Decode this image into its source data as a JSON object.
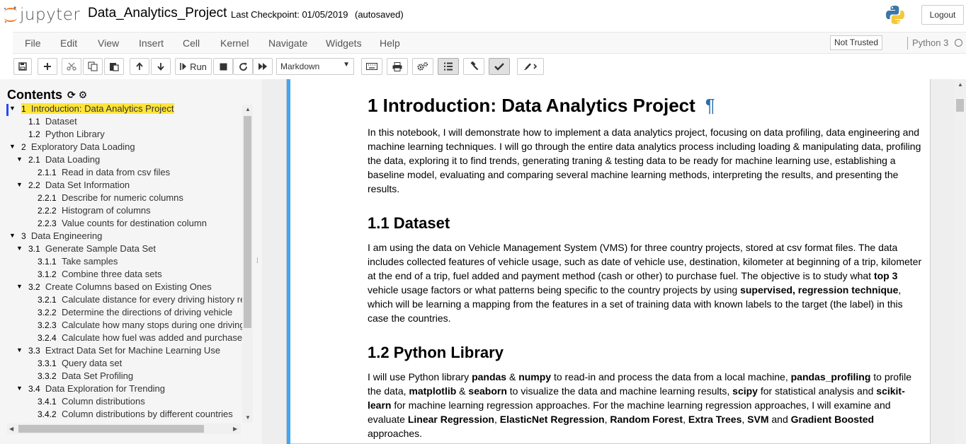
{
  "header": {
    "logo_text": "jupyter",
    "notebook_name": "Data_Analytics_Project",
    "checkpoint": "Last Checkpoint: 01/05/2019",
    "autosave": "(autosaved)",
    "logout_label": "Logout"
  },
  "menubar": {
    "items": [
      "File",
      "Edit",
      "View",
      "Insert",
      "Cell",
      "Kernel",
      "Navigate",
      "Widgets",
      "Help"
    ],
    "trust_label": "Not Trusted",
    "kernel_name": "Python 3"
  },
  "toolbar": {
    "run_label": "Run",
    "cell_type": "Markdown",
    "buttons": [
      "save-icon",
      "plus-icon",
      "cut-icon",
      "copy-icon",
      "paste-icon",
      "arrow-up-icon",
      "arrow-down-icon",
      "run-icon",
      "stop-icon",
      "restart-icon",
      "fast-forward-icon",
      "keyboard-icon",
      "print-icon",
      "gears-icon",
      "list-icon",
      "gavel-icon",
      "check-icon",
      "brush-icon"
    ]
  },
  "toc": {
    "title": "Contents",
    "items": [
      {
        "num": "1",
        "label": "Introduction: Data Analytics Project",
        "current": true
      },
      {
        "num": "1.1",
        "label": "Dataset"
      },
      {
        "num": "1.2",
        "label": "Python Library"
      },
      {
        "num": "2",
        "label": "Exploratory Data Loading"
      },
      {
        "num": "2.1",
        "label": "Data Loading"
      },
      {
        "num": "2.1.1",
        "label": "Read in data from csv files"
      },
      {
        "num": "2.2",
        "label": "Data Set Information"
      },
      {
        "num": "2.2.1",
        "label": "Describe for numeric columns"
      },
      {
        "num": "2.2.2",
        "label": "Histogram of columns"
      },
      {
        "num": "2.2.3",
        "label": "Value counts for destination column"
      },
      {
        "num": "3",
        "label": "Data Engineering"
      },
      {
        "num": "3.1",
        "label": "Generate Sample Data Set"
      },
      {
        "num": "3.1.1",
        "label": "Take samples"
      },
      {
        "num": "3.1.2",
        "label": "Combine three data sets"
      },
      {
        "num": "3.2",
        "label": "Create Columns based on Existing Ones"
      },
      {
        "num": "3.2.1",
        "label": "Calculate distance for every driving history re"
      },
      {
        "num": "3.2.2",
        "label": "Determine the directions of driving vehicle"
      },
      {
        "num": "3.2.3",
        "label": "Calculate how many stops during one driving"
      },
      {
        "num": "3.2.4",
        "label": "Calculate how fuel was added and purchase"
      },
      {
        "num": "3.3",
        "label": "Extract Data Set for Machine Learning Use"
      },
      {
        "num": "3.3.1",
        "label": "Query data set"
      },
      {
        "num": "3.3.2",
        "label": "Data Set Profiling"
      },
      {
        "num": "3.4",
        "label": "Data Exploration for Trending"
      },
      {
        "num": "3.4.1",
        "label": "Column distributions"
      },
      {
        "num": "3.4.2",
        "label": "Column distributions by different countries"
      }
    ]
  },
  "notebook": {
    "h1": "1  Introduction: Data Analytics Project",
    "pilcrow": "¶",
    "intro": "In this notebook, I will demonstrate how to implement a data analytics project, focusing on data profiling, data engineering and machine learning techniques. I will go through the entire data analytics process including loading & manipulating data, profiling the data, exploring it to find trends, generating traning & testing data to be ready for machine learning use, establishing a baseline model, evaluating and comparing several machine learning methods, interpreting the results, and presenting the results.",
    "h2_dataset": "1.1  Dataset",
    "dataset_p1": "I am using the data on Vehicle Management System (VMS) for three country projects, stored at csv format files. The data includes collected features of vehicle usage, such as date of vehicle use, destination, kilometer at beginning of a trip, kilometer at the end of a trip, fuel added and payment method (cash or other) to purchase fuel. The objective is to study what ",
    "dataset_b1": "top 3",
    "dataset_p2": " vehicle usage factors or what patterns being specific to the country projects by using ",
    "dataset_b2": "supervised, regression technique",
    "dataset_p3": ", which will be learning a mapping from the features in a set of training data with known labels to the target (the label) in this case the countries.",
    "h2_python": "1.2  Python Library",
    "py_parts": [
      {
        "t": "I will use Python library ",
        "b": false
      },
      {
        "t": "pandas",
        "b": true
      },
      {
        "t": " & ",
        "b": false
      },
      {
        "t": "numpy",
        "b": true
      },
      {
        "t": " to read-in and process the data from a local machine, ",
        "b": false
      },
      {
        "t": "pandas_profiling",
        "b": true
      },
      {
        "t": " to profile the data, ",
        "b": false
      },
      {
        "t": "matplotlib",
        "b": true
      },
      {
        "t": " & ",
        "b": false
      },
      {
        "t": "seaborn",
        "b": true
      },
      {
        "t": " to visualize the data and machine learning results, ",
        "b": false
      },
      {
        "t": "scipy",
        "b": true
      },
      {
        "t": " for statistical analysis and ",
        "b": false
      },
      {
        "t": "scikit-learn",
        "b": true
      },
      {
        "t": " for machine learning regression approaches. For the machine learning regression approaches, I will examine and evaluate ",
        "b": false
      },
      {
        "t": "Linear Regression",
        "b": true
      },
      {
        "t": ", ",
        "b": false
      },
      {
        "t": "ElasticNet Regression",
        "b": true
      },
      {
        "t": ", ",
        "b": false
      },
      {
        "t": "Random Forest",
        "b": true
      },
      {
        "t": ", ",
        "b": false
      },
      {
        "t": "Extra Trees",
        "b": true
      },
      {
        "t": ", ",
        "b": false
      },
      {
        "t": "SVM",
        "b": true
      },
      {
        "t": " and ",
        "b": false
      },
      {
        "t": "Gradient Boosted",
        "b": true
      },
      {
        "t": " approaches.",
        "b": false
      }
    ]
  },
  "colors": {
    "accent": "#42a5f5",
    "toc_highlight": "#ffe53a",
    "toc_marker": "#2747ff",
    "jupyter_orange": "#f37726"
  }
}
